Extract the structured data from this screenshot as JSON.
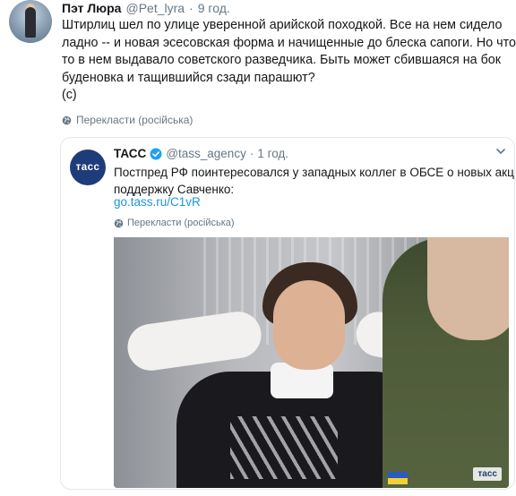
{
  "tweet": {
    "author_name": "Пэт Люра",
    "author_handle": "@Pet_lyra",
    "separator": "·",
    "time": "9 год.",
    "text_lines": [
      "Штирлиц шел по улице уверенной арийской походкой. Все на нем сидело",
      "ладно -- и новая эсесовская форма и начищенные до блеска сапоги. Но что",
      "то в нем выдавало советского разведчика. Быть может сбившаяся на бок",
      "буденовка и тащившийся сзади парашют?",
      "(с)"
    ],
    "translate_label": "Перекласти (російська)",
    "translate_icon": "globe-icon",
    "avatar_icon": "avatar"
  },
  "quoted": {
    "author_name": "ТАСС",
    "verified_icon": "verified-badge-icon",
    "author_handle": "@tass_agency",
    "separator": "·",
    "time": "1 год.",
    "text_lines": [
      "Постпред РФ поинтересовался у западных коллег в ОБСЕ о новых акциях в",
      "поддержку Савченко:"
    ],
    "link": "go.tass.ru/C1vR",
    "translate_label": "Перекласти (російська)",
    "logo_text": "тасс",
    "photo_watermark": "тасс",
    "menu_icon": "chevron-down-icon"
  },
  "colors": {
    "link": "#1b95e0",
    "secondary_text": "#657786",
    "primary_text": "#14171a",
    "border": "#e1e8ed",
    "tass_brand": "#1f3c7a",
    "verified": "#1da1f2"
  }
}
